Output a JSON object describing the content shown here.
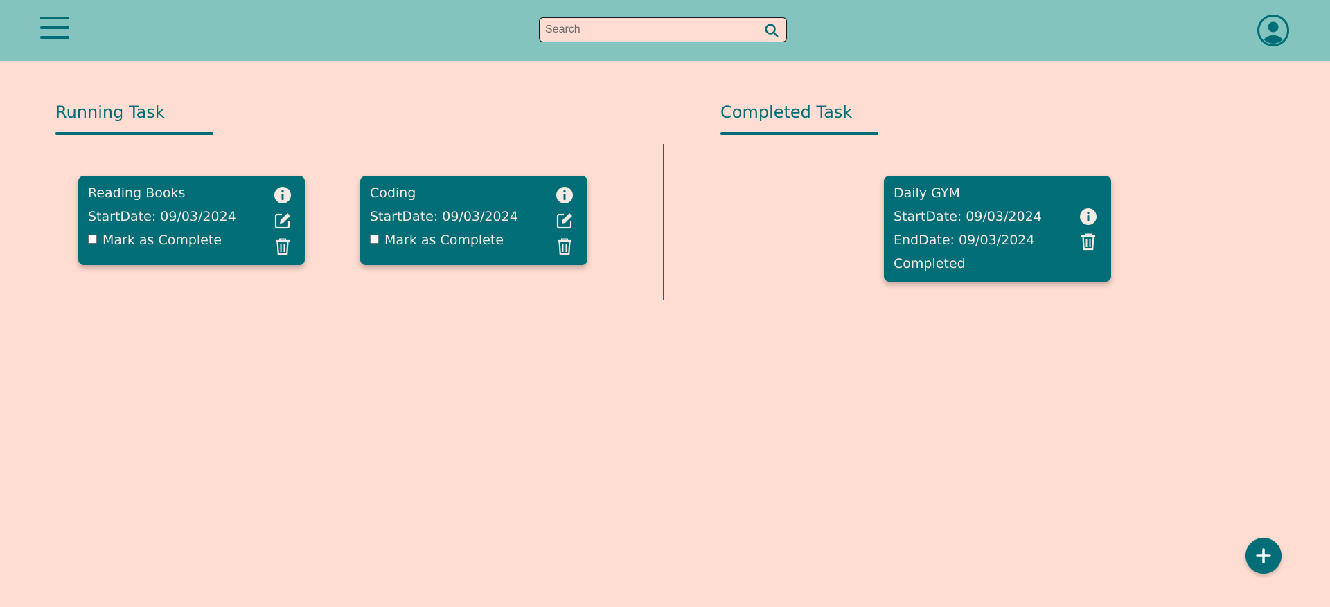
{
  "header": {
    "search": {
      "placeholder": "Search",
      "value": ""
    }
  },
  "running": {
    "title": "Running Task",
    "tasks": [
      {
        "title": "Reading Books",
        "start": "StartDate: 09/03/2024",
        "mark_label": "Mark as Complete"
      },
      {
        "title": "Coding",
        "start": "StartDate: 09/03/2024",
        "mark_label": "Mark as Complete"
      }
    ]
  },
  "completed": {
    "title": "Completed Task",
    "tasks": [
      {
        "title": "Daily GYM",
        "start": "StartDate: 09/03/2024",
        "end": "EndDate: 09/03/2024",
        "status": "Completed"
      }
    ]
  },
  "icons": [
    "menu-icon",
    "search-icon",
    "user-avatar-icon",
    "info-icon",
    "edit-icon",
    "trash-icon",
    "plus-icon"
  ],
  "colors": {
    "header_bg": "#83c5be",
    "page_bg": "#ffddd2",
    "accent": "#006d77",
    "card_text": "#f4eae3"
  }
}
